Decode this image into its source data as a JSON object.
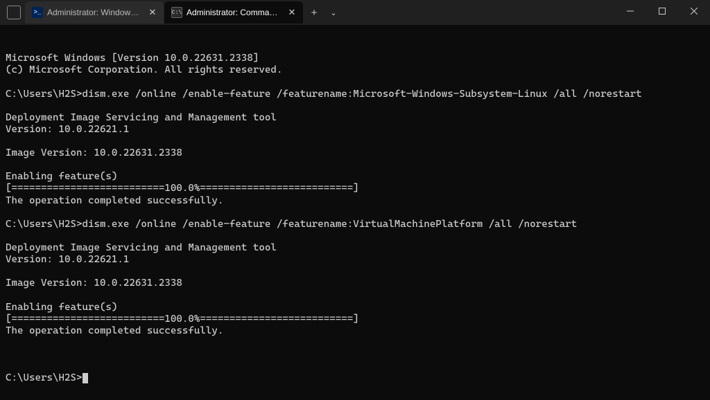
{
  "tabs": [
    {
      "label": "Administrator: Windows Power",
      "icon_text": ">_",
      "active": false,
      "icon_kind": "ps"
    },
    {
      "label": "Administrator: Command Pro",
      "icon_text": "C:\\",
      "active": true,
      "icon_kind": "cmd"
    }
  ],
  "terminal": {
    "lines": [
      "Microsoft Windows [Version 10.0.22631.2338]",
      "(c) Microsoft Corporation. All rights reserved.",
      "",
      "C:\\Users\\H2S>dism.exe /online /enable-feature /featurename:Microsoft-Windows-Subsystem-Linux /all /norestart",
      "",
      "Deployment Image Servicing and Management tool",
      "Version: 10.0.22621.1",
      "",
      "Image Version: 10.0.22631.2338",
      "",
      "Enabling feature(s)",
      "[==========================100.0%==========================]",
      "The operation completed successfully.",
      "",
      "C:\\Users\\H2S>dism.exe /online /enable-feature /featurename:VirtualMachinePlatform /all /norestart",
      "",
      "Deployment Image Servicing and Management tool",
      "Version: 10.0.22621.1",
      "",
      "Image Version: 10.0.22631.2338",
      "",
      "Enabling feature(s)",
      "[==========================100.0%==========================]",
      "The operation completed successfully.",
      ""
    ],
    "prompt": "C:\\Users\\H2S>"
  },
  "buttons": {
    "new_tab": "+",
    "dropdown": "⌄",
    "close_tab": "✕"
  }
}
